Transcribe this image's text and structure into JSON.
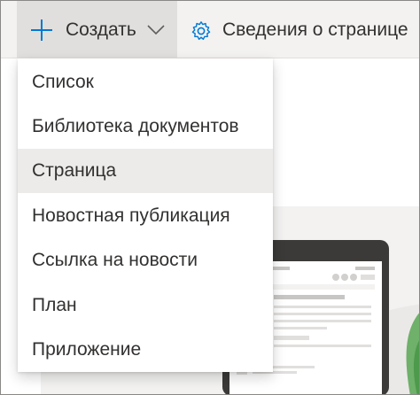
{
  "command_bar": {
    "new_label": "Создать",
    "new_icon": "plus-icon",
    "new_chevron_icon": "chevron-down-icon",
    "details_label": "Сведения о странице",
    "details_icon": "gear-icon",
    "accent_color": "#0078d4"
  },
  "menu": {
    "items": [
      {
        "label": "Список"
      },
      {
        "label": "Библиотека документов"
      },
      {
        "label": "Страница"
      },
      {
        "label": "Новостная публикация"
      },
      {
        "label": "Ссылка на новости"
      },
      {
        "label": "План"
      },
      {
        "label": "Приложение"
      }
    ],
    "highlighted": "Страница",
    "highlight_color": "#edebe9"
  }
}
